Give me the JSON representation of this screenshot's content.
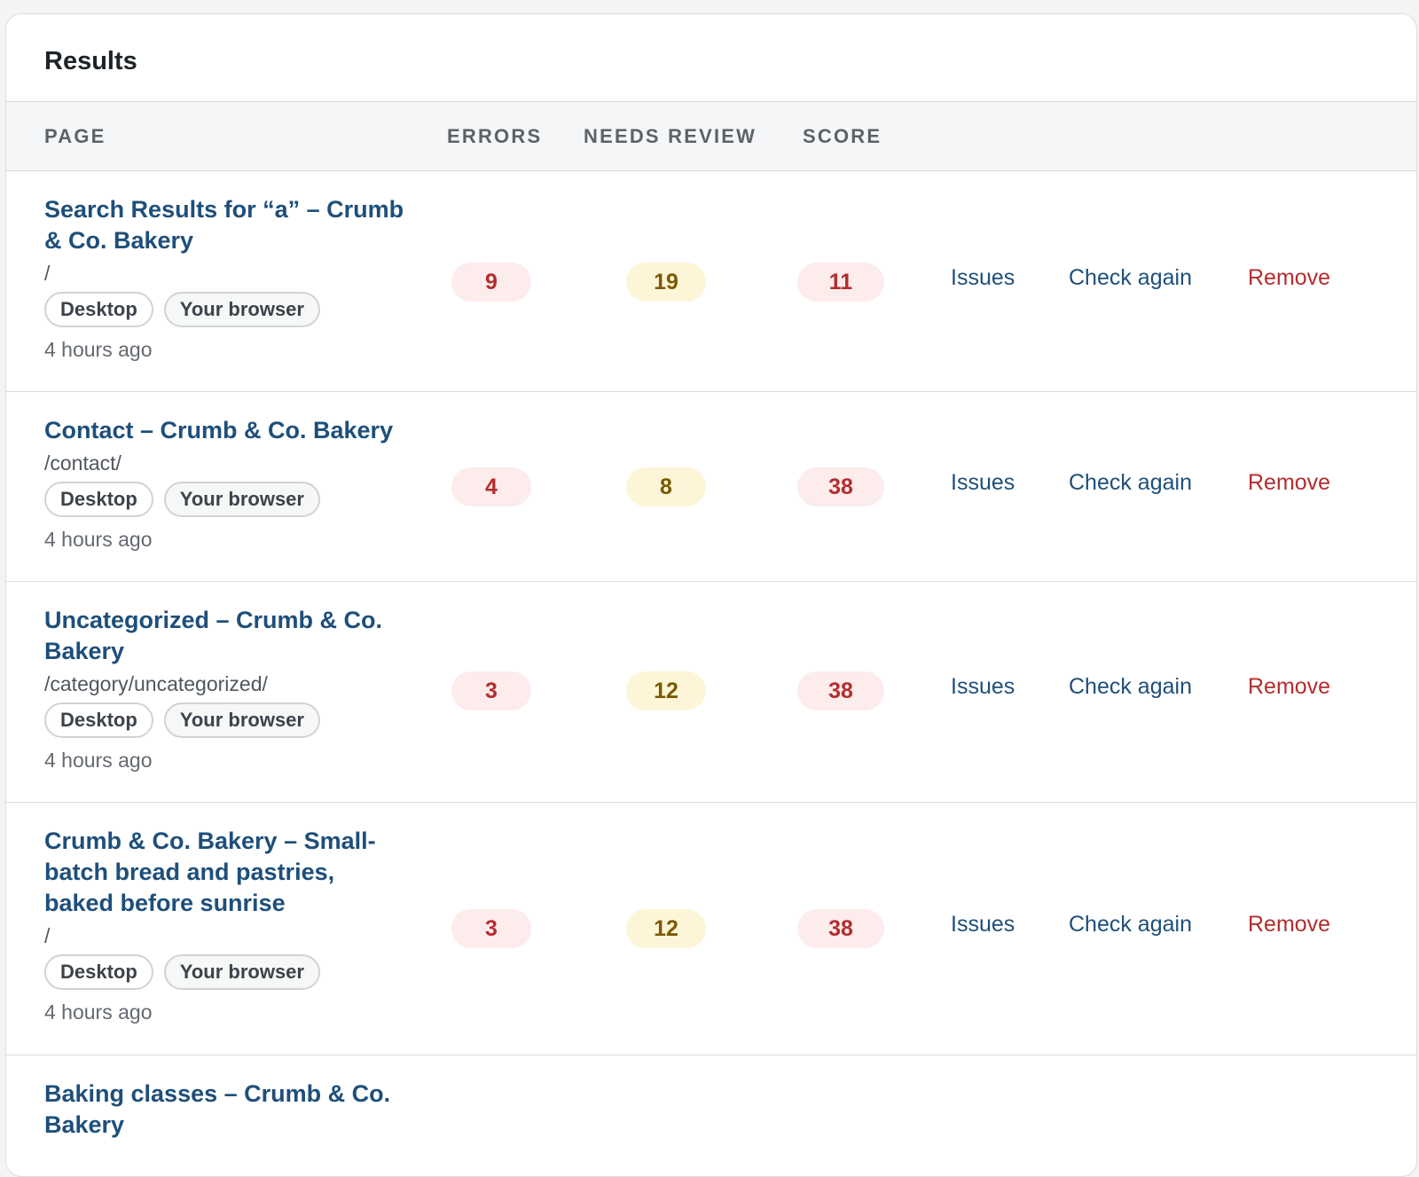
{
  "panel": {
    "title": "Results"
  },
  "table": {
    "headers": {
      "page": "PAGE",
      "errors": "ERRORS",
      "needs_review": "NEEDS REVIEW",
      "score": "SCORE"
    },
    "rows": [
      {
        "title": "Search Results for “a” – Crumb & Co. Bakery",
        "path": "/",
        "tags": [
          "Desktop",
          "Your browser"
        ],
        "time": "4 hours ago",
        "errors": "9",
        "needs_review": "19",
        "score": "11",
        "actions": {
          "issues": "Issues",
          "check_again": "Check again",
          "remove": "Remove"
        }
      },
      {
        "title": "Contact – Crumb & Co. Bakery",
        "path": "/contact/",
        "tags": [
          "Desktop",
          "Your browser"
        ],
        "time": "4 hours ago",
        "errors": "4",
        "needs_review": "8",
        "score": "38",
        "actions": {
          "issues": "Issues",
          "check_again": "Check again",
          "remove": "Remove"
        }
      },
      {
        "title": "Uncategorized – Crumb & Co. Bakery",
        "path": "/category/uncategorized/",
        "tags": [
          "Desktop",
          "Your browser"
        ],
        "time": "4 hours ago",
        "errors": "3",
        "needs_review": "12",
        "score": "38",
        "actions": {
          "issues": "Issues",
          "check_again": "Check again",
          "remove": "Remove"
        }
      },
      {
        "title": "Crumb & Co. Bakery – Small-batch bread and pastries, baked before sunrise",
        "path": "/",
        "tags": [
          "Desktop",
          "Your browser"
        ],
        "time": "4 hours ago",
        "errors": "3",
        "needs_review": "12",
        "score": "38",
        "actions": {
          "issues": "Issues",
          "check_again": "Check again",
          "remove": "Remove"
        }
      },
      {
        "title": "Baking classes – Crumb & Co. Bakery"
      }
    ]
  },
  "colors": {
    "link": "#1e4f7b",
    "error": "#b32d2e",
    "error_bg": "#fdecec",
    "review": "#7a5a00",
    "review_bg": "#fdf5d8"
  }
}
